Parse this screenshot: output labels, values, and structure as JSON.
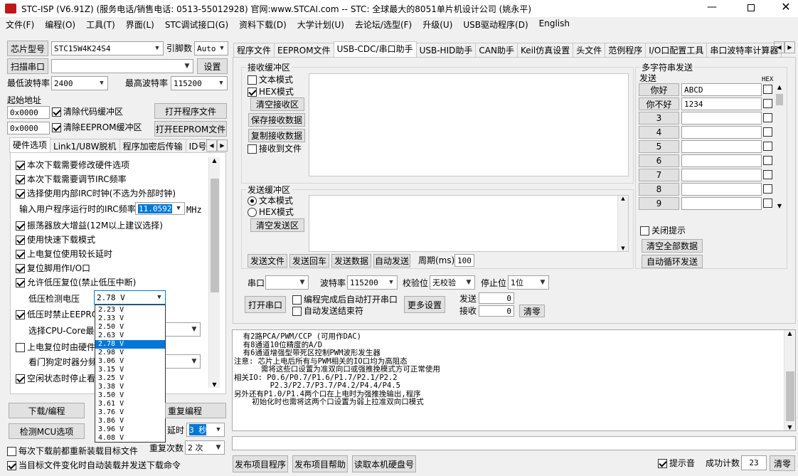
{
  "window": {
    "title": "STC-ISP (V6.91Z) (服务电话/销售电话: 0513-55012928) 官网:www.STCAI.com  -- STC: 全球最大的8051单片机设计公司 (姚永平)"
  },
  "menu": [
    "文件(F)",
    "编程(O)",
    "工具(T)",
    "界面(L)",
    "STC调试接口(G)",
    "资料下载(D)",
    "大学计划(U)",
    "去论坛/选型(F)",
    "升级(U)",
    "USB驱动程序(D)",
    "English"
  ],
  "left": {
    "chip_label": "芯片型号",
    "chip_value": "STC15W4K24S4",
    "pin_label": "引脚数",
    "pin_value": "Auto",
    "scan_label": "扫描串口",
    "port_value": "",
    "settings_label": "设置",
    "min_baud_label": "最低波特率",
    "min_baud_value": "2400",
    "max_baud_label": "最高波特率",
    "max_baud_value": "115200",
    "start_addr_label": "起始地址",
    "addr1": "0x0000",
    "clear_code_label": "清除代码缓冲区",
    "open_prog_label": "打开程序文件",
    "addr2": "0x0000",
    "clear_eeprom_label": "清除EEPROM缓冲区",
    "open_eeprom_label": "打开EEPROM文件",
    "tabs": [
      "硬件选项",
      "Link1/U8W脱机",
      "程序加密后传输",
      "ID号"
    ],
    "options": [
      {
        "label": "本次下载需要修改硬件选项",
        "checked": true
      },
      {
        "label": "本次下载需要调节IRC频率",
        "checked": true
      },
      {
        "label": "选择使用内部IRC时钟(不选为外部时钟)",
        "checked": true
      }
    ],
    "irc_label": "输入用户程序运行时的IRC频率",
    "irc_value": "11.0592",
    "irc_unit": "MHz",
    "options2": [
      {
        "label": "振荡器放大增益(12M以上建议选择)",
        "checked": true
      },
      {
        "label": "使用快速下载模式",
        "checked": true
      },
      {
        "label": "上电复位使用较长延时",
        "checked": true
      },
      {
        "label": "复位脚用作I/O口",
        "checked": true
      },
      {
        "label": "允许低压复位(禁止低压中断)",
        "checked": true
      }
    ],
    "lv_label": "低压检测电压",
    "lv_value": "2.78 V",
    "lv_options": [
      "2.23 V",
      "2.33 V",
      "2.50 V",
      "2.63 V",
      "2.78 V",
      "2.98 V",
      "3.06 V",
      "3.15 V",
      "3.25 V",
      "3.38 V",
      "3.50 V",
      "3.61 V",
      "3.76 V",
      "3.86 V",
      "3.96 V",
      "4.08 V"
    ],
    "lv_selected_index": 4,
    "opt_lv_eeprom": "低压时禁止EEPROM",
    "opt_cpu_core": "选择CPU-Core最高",
    "opt_poweron": "上电复位时由硬件",
    "opt_watchdog": "看门狗定时器分频",
    "opt_idle": "空闲状态时停止看",
    "download_label": "下载/编程",
    "repeat_prog_label": "重复编程",
    "detect_label": "检测MCU选项",
    "delay_label": "延时",
    "delay_value": "3 秒",
    "reload_label": "每次下载前都重新装载目标文件",
    "repeat_count_label": "重复次数",
    "repeat_count_value": "2 次",
    "auto_reload_label": "当目标文件变化时自动装载并发送下载命令"
  },
  "right": {
    "tabs": [
      "程序文件",
      "EEPROM文件",
      "USB-CDC/串口助手",
      "USB-HID助手",
      "CAN助手",
      "Keil仿真设置",
      "头文件",
      "范例程序",
      "I/O口配置工具",
      "串口波特率计算器"
    ],
    "active_tab": 2,
    "recv_title": "接收缓冲区",
    "text_mode": "文本模式",
    "hex_mode": "HEX模式",
    "clear_recv": "清空接收区",
    "save_recv": "保存接收数据",
    "copy_recv": "复制接收数据",
    "recv_to_file": "接收到文件",
    "send_title": "发送缓冲区",
    "send_text_mode": "文本模式",
    "send_hex_mode": "HEX模式",
    "clear_send": "清空发送区",
    "send_file": "发送文件",
    "send_enter": "发送回车",
    "send_data": "发送数据",
    "auto_send": "自动发送",
    "period_label": "周期(ms)",
    "period_value": "100",
    "multi_title": "多字符串发送",
    "send_col": "发送",
    "hex_col": "HEX",
    "multi_rows": [
      {
        "btn": "你好",
        "value": "ABCD"
      },
      {
        "btn": "你不好",
        "value": "1234"
      },
      {
        "btn": "3",
        "value": ""
      },
      {
        "btn": "4",
        "value": ""
      },
      {
        "btn": "5",
        "value": ""
      },
      {
        "btn": "6",
        "value": ""
      },
      {
        "btn": "7",
        "value": ""
      },
      {
        "btn": "8",
        "value": ""
      },
      {
        "btn": "9",
        "value": ""
      }
    ],
    "close_tip": "关闭提示",
    "clear_all": "清空全部数据",
    "auto_loop": "自动循环发送",
    "port_label": "串口",
    "port_value": "",
    "baud_label": "波特率",
    "baud_value": "115200",
    "parity_label": "校验位",
    "parity_value": "无校验",
    "stop_label": "停止位",
    "stop_value": "1位",
    "open_port": "打开串口",
    "auto_open": "编程完成后自动打开串口",
    "auto_send_end": "自动发送结束符",
    "more_settings": "更多设置",
    "send_count_label": "发送",
    "send_count": "0",
    "recv_count_label": "接收",
    "recv_count": "0",
    "clear_count": "清零"
  },
  "log": {
    "lines": [
      "  有2路PCA/PWM/CCP (可用作DAC)",
      "  有8通道10位精度的A/D",
      "  有6通道增强型带死区控制PWM波形发生器",
      "",
      "注意: 芯片上电后所有与PWM相关的IO口均为高阻态",
      "      需将这些口设置为准双向口或强推挽模式方可正常使用",
      "相关IO: P0.6/P0.7/P1.6/P1.7/P2.1/P2.2",
      "        P2.3/P2.7/P3.7/P4.2/P4.4/P4.5",
      "另外还有P1.0/P1.4两个口在上电时为强推挽输出,程序",
      "    初始化时也需将这两个口设置为弱上拉准双向口模式"
    ]
  },
  "bottom": {
    "publish_prog": "发布项目程序",
    "publish_help": "发布项目帮助",
    "read_disk": "读取本机硬盘号",
    "sound_label": "提示音",
    "success_label": "成功计数",
    "success_count": "23",
    "clear_label": "清零"
  }
}
